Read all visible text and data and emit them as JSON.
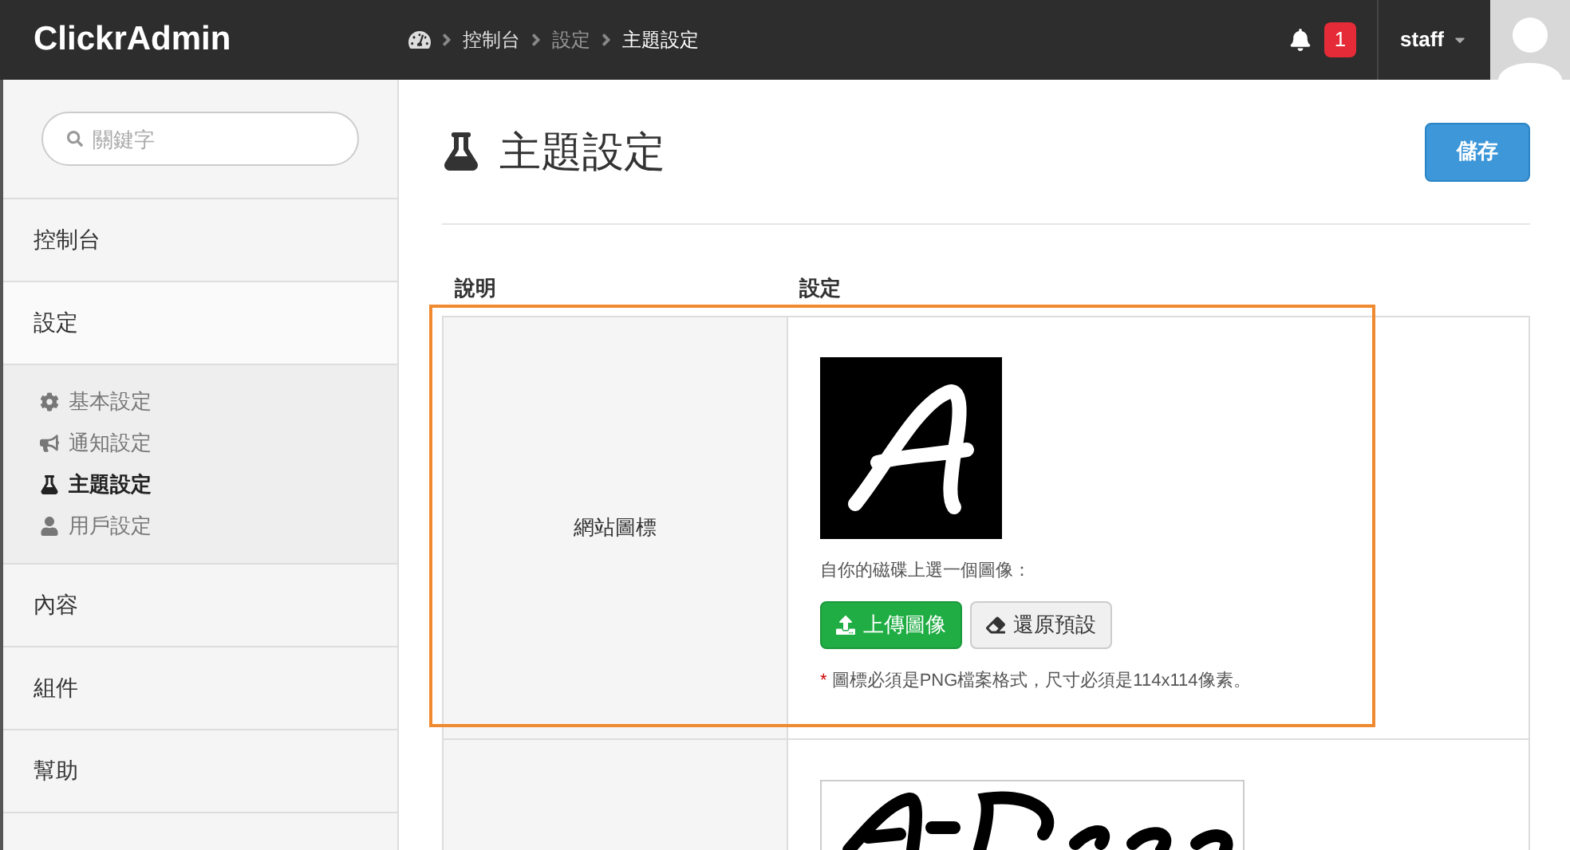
{
  "brand": "ClickrAdmin",
  "breadcrumb": [
    {
      "label": "控制台",
      "current": false
    },
    {
      "label": "設定",
      "current": false
    },
    {
      "label": "主題設定",
      "current": true
    }
  ],
  "notifications": {
    "count": "1"
  },
  "user": {
    "name": "staff"
  },
  "sidebar": {
    "search": {
      "placeholder": "關鍵字"
    },
    "items": [
      {
        "label": "控制台"
      },
      {
        "label": "設定",
        "children": [
          {
            "label": "基本設定",
            "selected": false
          },
          {
            "label": "通知設定",
            "selected": false
          },
          {
            "label": "主題設定",
            "selected": true
          },
          {
            "label": "用戶設定",
            "selected": false
          }
        ]
      },
      {
        "label": "內容"
      },
      {
        "label": "組件"
      },
      {
        "label": "幫助"
      }
    ]
  },
  "page": {
    "title": "主題設定",
    "save_button": "儲存"
  },
  "table": {
    "columns": [
      "說明",
      "設定"
    ],
    "rows": [
      {
        "label": "網站圖標",
        "kind": "icon",
        "highlighted": true,
        "prompt": "自你的磁碟上選一個圖像：",
        "upload_button": "上傳圖像",
        "reset_button": "還原預設",
        "note_mark": "*",
        "note": "圖標必須是PNG檔案格式，尺寸必須是114x114像素。"
      },
      {
        "kind": "banner"
      }
    ]
  }
}
